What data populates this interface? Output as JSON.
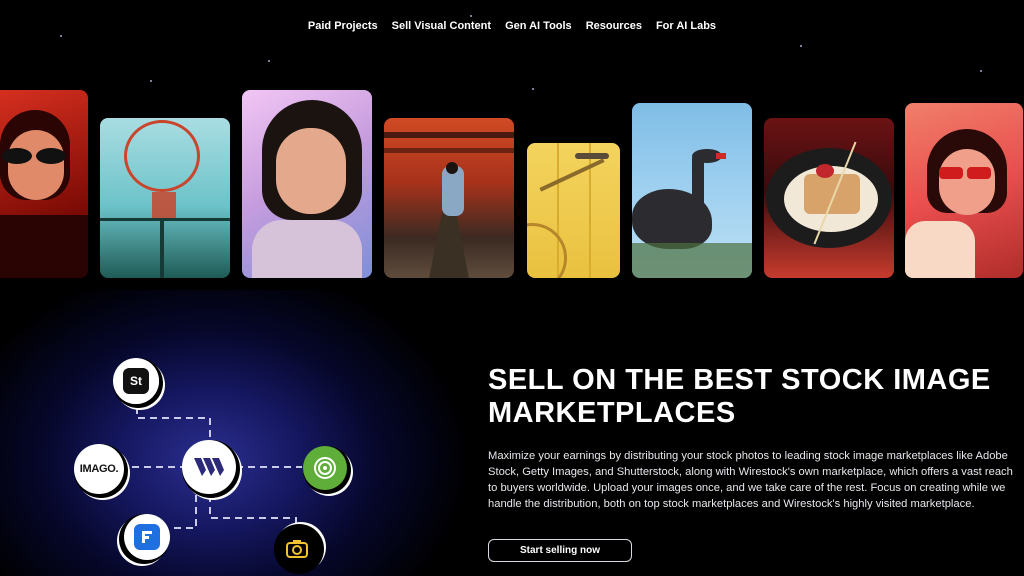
{
  "nav": {
    "items": [
      {
        "label": "Paid Projects"
      },
      {
        "label": "Sell Visual Content"
      },
      {
        "label": "Gen AI Tools"
      },
      {
        "label": "Resources"
      },
      {
        "label": "For AI Labs"
      }
    ]
  },
  "hero": {
    "headline_line1": "SELL ON THE BEST STOCK IMAGE",
    "headline_line2": "MARKETPLACES",
    "description": "Maximize your earnings by distributing your stock photos to leading stock image marketplaces like Adobe Stock, Getty Images, and Shutterstock, along with Wirestock's own marketplace, which offers a vast reach to buyers worldwide. Upload your images once, and we take care of the rest. Focus on creating while we handle the distribution, both on top stock marketplaces and Wirestock's highly visited marketplace.",
    "cta_label": "Start selling now"
  },
  "diagram": {
    "nodes": {
      "shutterstock_label": "St",
      "imago_label": "IMAGO.",
      "center_icon": "wirestock-logo-icon",
      "right_icon": "green-spiral-icon",
      "bottom_left_icon": "f-logo-icon",
      "bottom_right_icon": "camera-badge-icon"
    }
  },
  "gallery": {
    "images": [
      {
        "subject": "woman-red-sunglasses"
      },
      {
        "subject": "basketball-hoop"
      },
      {
        "subject": "woman-portrait-pastel"
      },
      {
        "subject": "torii-gates-path"
      },
      {
        "subject": "yellow-bicycle"
      },
      {
        "subject": "black-swan"
      },
      {
        "subject": "dessert-plate"
      },
      {
        "subject": "woman-red-glasses"
      }
    ]
  },
  "colors": {
    "background": "#000000",
    "glow": "#2b2f8f",
    "text": "#ffffff"
  }
}
